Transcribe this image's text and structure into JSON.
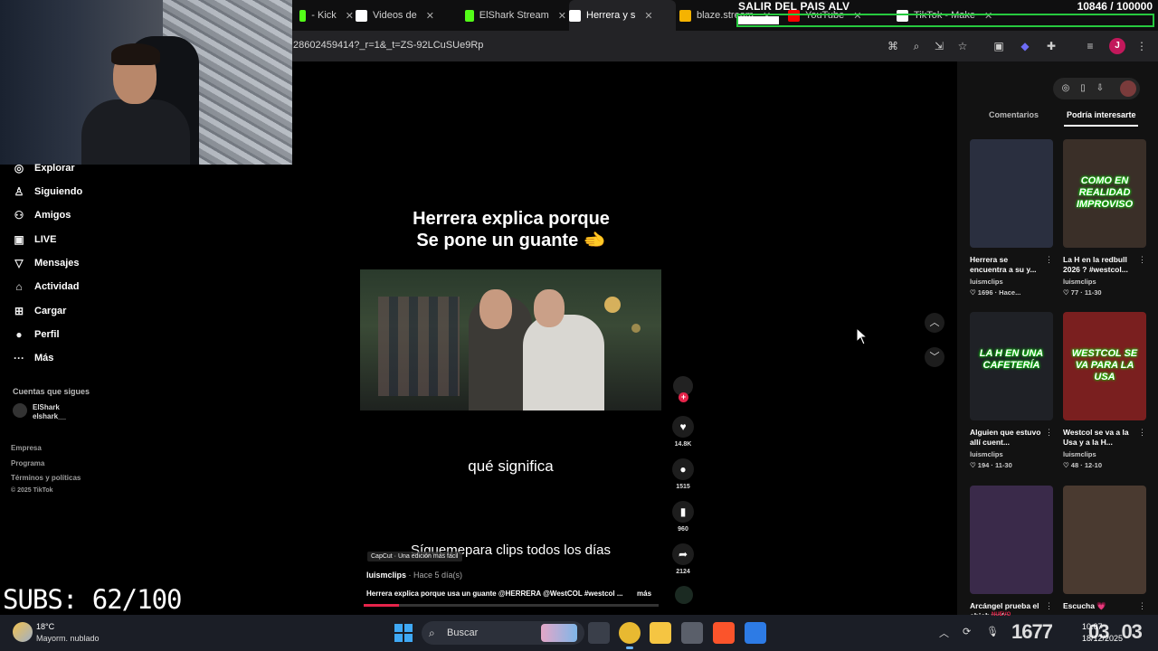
{
  "browser": {
    "tabs": [
      {
        "label": "- Kick",
        "icon_color": "#53fc18",
        "active": false
      },
      {
        "label": "Videos de",
        "icon_color": "#ffffff",
        "active": false
      },
      {
        "label": "ElShark Stream",
        "icon_color": "#53fc18",
        "active": false
      },
      {
        "label": "Herrera y s",
        "icon_color": "#ffffff",
        "active": true
      },
      {
        "label": "blaze.stream",
        "icon_color": "#f5b301",
        "active": false
      },
      {
        "label": "YouTube",
        "icon_color": "#ff0000",
        "active": false
      },
      {
        "label": "TikTok - Make",
        "icon_color": "#ffffff",
        "active": false
      }
    ],
    "url": "28602459414?_r=1&_t=ZS-92LCuSUe9Rp",
    "toolbar_icons": [
      "translate-icon",
      "zoom-icon",
      "install-icon",
      "bookmark-star-icon",
      "screenshot-icon",
      "extension-shield-icon",
      "puzzle-icon",
      "media-icon"
    ],
    "profile_initial": "J"
  },
  "stream_overlay": {
    "goal_title": "SALIR DEL PAIS ALV",
    "goal_count": "10846 / 100000",
    "goal_progress": 0.108,
    "subs": "SUBS: 62/100",
    "ticker_a": "1677",
    "ticker_b": "03",
    "ticker_c": "03"
  },
  "tiktok_nav": {
    "items": [
      {
        "label": "Explorar",
        "icon": "compass-icon",
        "glyph": "◎"
      },
      {
        "label": "Siguiendo",
        "icon": "following-icon",
        "glyph": "♙"
      },
      {
        "label": "Amigos",
        "icon": "friends-icon",
        "glyph": "⚇"
      },
      {
        "label": "LIVE",
        "icon": "live-icon",
        "glyph": "▣"
      },
      {
        "label": "Mensajes",
        "icon": "messages-icon",
        "glyph": "▽"
      },
      {
        "label": "Actividad",
        "icon": "activity-icon",
        "glyph": "⌂"
      },
      {
        "label": "Cargar",
        "icon": "upload-icon",
        "glyph": "⊞"
      },
      {
        "label": "Perfil",
        "icon": "profile-icon",
        "glyph": "●"
      },
      {
        "label": "Más",
        "icon": "more-icon",
        "glyph": "···"
      }
    ],
    "following_title": "Cuentas que sigues",
    "following_account": {
      "display": "ElShark",
      "handle": "elshark__"
    },
    "footer": [
      "Empresa",
      "Programa",
      "Términos y políticas",
      "© 2025 TikTok"
    ]
  },
  "video": {
    "heading_line1": "Herrera explica porque",
    "heading_line2": "Se pone un guante 🫲",
    "caption1": "qué significa",
    "caption2": "Síguemepara clips todos los días",
    "capcut": "CapCut · Una edición más fácil",
    "author": "luismclips",
    "ago": " · Hace 5 día(s)",
    "description": "Herrera explica porque usa un guante @HERRERA @WestCOL #westcol ...",
    "more": "más",
    "progress": 0.12,
    "actions": [
      {
        "name": "like",
        "icon": "heart-icon",
        "glyph": "♥",
        "count": "14.8K"
      },
      {
        "name": "comment",
        "icon": "comment-icon",
        "glyph": "●",
        "count": "1515"
      },
      {
        "name": "save",
        "icon": "bookmark-icon",
        "glyph": "▮",
        "count": "960"
      },
      {
        "name": "share",
        "icon": "share-icon",
        "glyph": "➦",
        "count": "2124"
      }
    ]
  },
  "right_panel": {
    "tab_comments": "Comentarios",
    "tab_suggested": "Podría interesarte",
    "cards": [
      {
        "title": "Herrera se encuentra a su y...",
        "author": "luismclips",
        "stats": "♡ 1696 · Hace...",
        "thumb_text": "",
        "thumb_color": "#2a2f3f"
      },
      {
        "title": "La H en la redbull 2026 ? #westcol...",
        "author": "luismclips",
        "stats": "♡ 77 · 11-30",
        "thumb_text": "COMO EN REALIDAD IMPROVISO",
        "thumb_color": "#3a2f28"
      },
      {
        "title": "Alguien que estuvo allí cuent...",
        "author": "luismclips",
        "stats": "♡ 194 · 11-30",
        "thumb_text": "LA H EN UNA CAFETERÍA",
        "thumb_color": "#1f2126"
      },
      {
        "title": "Westcol se va a la Usa y a la H...",
        "author": "luismclips",
        "stats": "♡ 48 · 12-10",
        "thumb_text": "WESTCOL SE VA PARA LA USA",
        "thumb_color": "#7a1f1f"
      },
      {
        "title": "Arcángel prueba el chicharrón...",
        "author": "",
        "stats": "",
        "thumb_text": "",
        "thumb_color": "#3a2a4a"
      },
      {
        "title": "Escucha 💗",
        "author": "",
        "stats": "",
        "thumb_text": "",
        "thumb_color": "#4a3a30"
      }
    ]
  },
  "taskbar": {
    "weather_temp": "18°C",
    "weather_desc": "Mayorm. nublado",
    "search": "Buscar",
    "apps": [
      {
        "name": "task-view",
        "color": "#3a3f4a"
      },
      {
        "name": "chrome",
        "color": "#e8b931"
      },
      {
        "name": "file-explorer",
        "color": "#f5c542"
      },
      {
        "name": "obs",
        "color": "#5a5f6a"
      },
      {
        "name": "brave",
        "color": "#fb542b"
      },
      {
        "name": "other-app",
        "color": "#2d7be5"
      }
    ],
    "clock_time": "10:07",
    "clock_date": "18/12/2025",
    "alert": "NUEVO"
  }
}
